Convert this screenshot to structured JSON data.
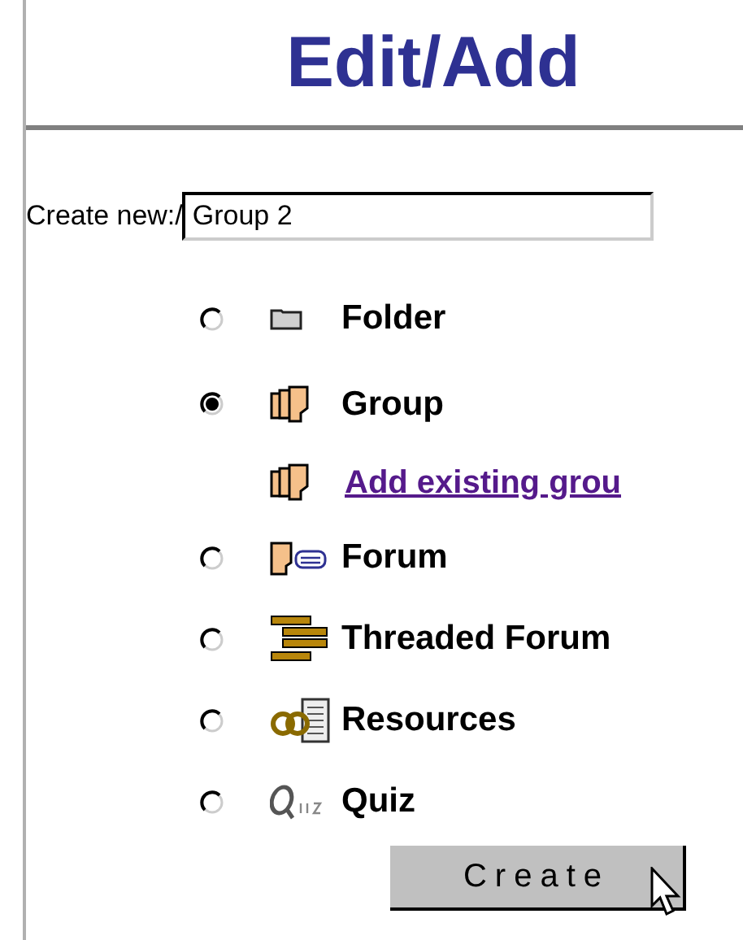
{
  "title": "Edit/Add",
  "create_new": {
    "label": "Create new:/",
    "value": "Group 2"
  },
  "items": [
    {
      "kind": "folder",
      "label": "Folder",
      "selected": false
    },
    {
      "kind": "group",
      "label": "Group",
      "selected": true
    },
    {
      "kind": "link",
      "label": "Add existing grou"
    },
    {
      "kind": "forum",
      "label": "Forum",
      "selected": false
    },
    {
      "kind": "threaded",
      "label": "Threaded Forum",
      "selected": false
    },
    {
      "kind": "resources",
      "label": "Resources",
      "selected": false
    },
    {
      "kind": "quiz",
      "label": "Quiz",
      "selected": false
    }
  ],
  "button": "Create"
}
